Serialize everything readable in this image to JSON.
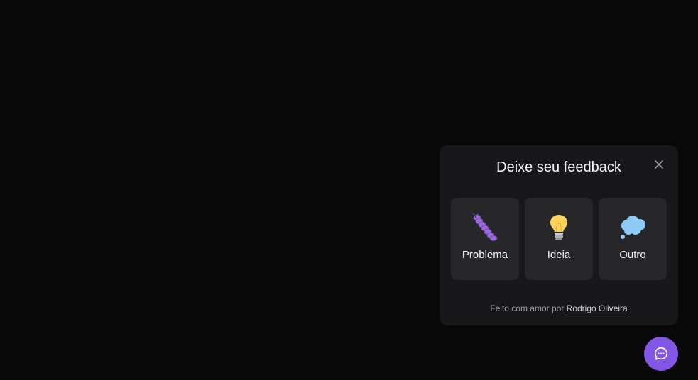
{
  "widget": {
    "title": "Deixe seu feedback",
    "close_icon": "close-icon",
    "options": [
      {
        "label": "Problema",
        "icon": "bug-icon"
      },
      {
        "label": "Ideia",
        "icon": "lightbulb-icon"
      },
      {
        "label": "Outro",
        "icon": "thought-bubble-icon"
      }
    ],
    "footer": {
      "prefix": "Feito com amor por ",
      "link": "Rodrigo Oliveira"
    }
  },
  "fab": {
    "icon": "chat-icon"
  },
  "colors": {
    "background": "#09090a",
    "panel": "#18181b",
    "card": "#27272a",
    "accent": "#8257e5",
    "text": "#f4f4f5"
  }
}
